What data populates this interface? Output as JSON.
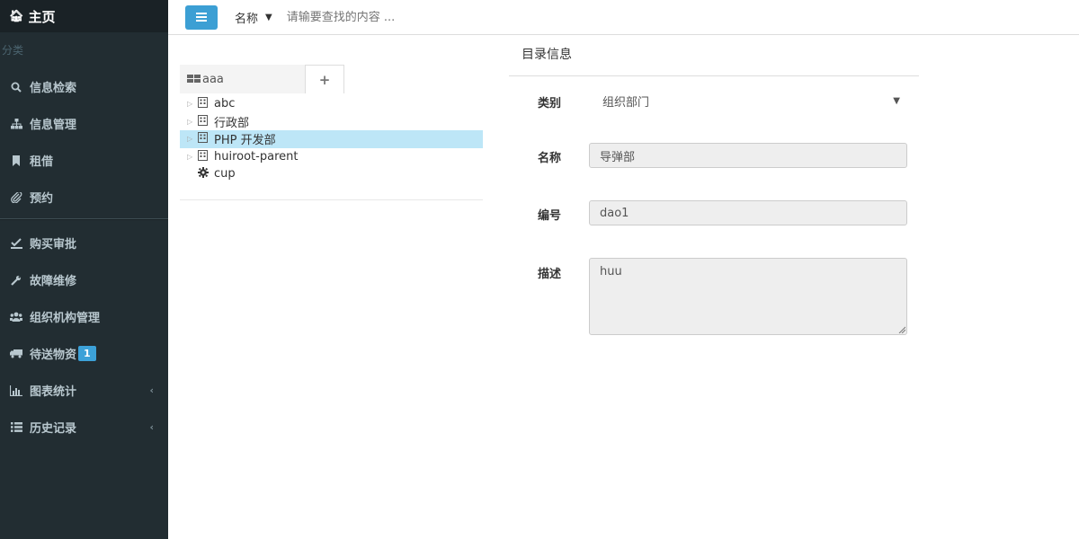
{
  "sidebar": {
    "brand": "主页",
    "section_title": "分类",
    "items_top": [
      {
        "label": "信息检索",
        "icon": "search-icon"
      },
      {
        "label": "信息管理",
        "icon": "sitemap-icon"
      },
      {
        "label": "租借",
        "icon": "bookmark-icon"
      },
      {
        "label": "预约",
        "icon": "paperclip-icon"
      }
    ],
    "items_bottom": [
      {
        "label": "购买审批",
        "icon": "check-icon"
      },
      {
        "label": "故障维修",
        "icon": "wrench-icon"
      },
      {
        "label": "组织机构管理",
        "icon": "users-icon"
      },
      {
        "label": "待送物资",
        "icon": "truck-icon",
        "badge": "1"
      },
      {
        "label": "图表统计",
        "icon": "bar-chart-icon",
        "chevron": "‹"
      },
      {
        "label": "历史记录",
        "icon": "list-icon",
        "chevron": "‹"
      }
    ]
  },
  "topbar": {
    "search_type": "名称",
    "search_placeholder": "请输要查找的内容 ..."
  },
  "tree": {
    "tab_label": "aaa",
    "add_label": "+",
    "nodes": [
      {
        "label": "abc",
        "type": "folder",
        "expandable": true
      },
      {
        "label": "行政部",
        "type": "folder",
        "expandable": true
      },
      {
        "label": "PHP 开发部",
        "type": "folder",
        "expandable": true,
        "selected": true
      },
      {
        "label": "huiroot-parent",
        "type": "folder",
        "expandable": true
      },
      {
        "label": "cup",
        "type": "gear",
        "expandable": false
      }
    ]
  },
  "detail": {
    "title": "目录信息",
    "category_label": "类别",
    "category_value": "组织部门",
    "name_label": "名称",
    "name_value": "导弹部",
    "code_label": "编号",
    "code_value": "dao1",
    "desc_label": "描述",
    "desc_value": "huu"
  },
  "colors": {
    "sidebar_bg": "#222d32",
    "accent": "#3c9fd4",
    "selected_row": "#bde6f7"
  }
}
